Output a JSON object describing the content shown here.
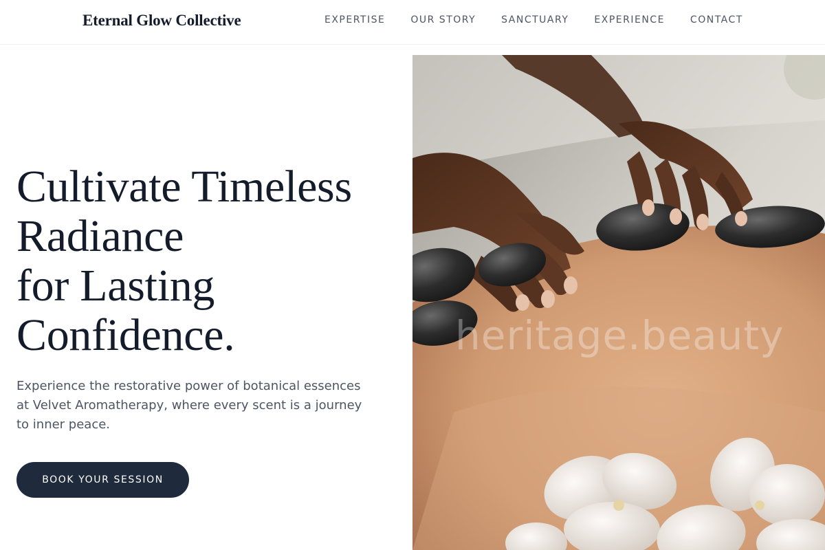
{
  "header": {
    "brand": "Eternal Glow Collective",
    "nav": [
      "EXPERTISE",
      "OUR STORY",
      "SANCTUARY",
      "EXPERIENCE",
      "CONTACT"
    ]
  },
  "hero": {
    "title_lines": [
      "Cultivate Timeless",
      "Radiance",
      "for Lasting",
      "Confidence."
    ],
    "subtitle": "Experience the restorative power of botanical essences at Velvet Aromatherapy, where every scent is a journey to inner peace.",
    "cta_label": "BOOK YOUR SESSION",
    "image": {
      "watermark": "heritage.beauty",
      "colors": {
        "skin": "#cf9a72",
        "hands": "#5a3522",
        "stones": "#2b2b2b",
        "flowers": "#ece6e0",
        "towel": "#d9d4cf"
      }
    }
  },
  "colors": {
    "text_dark": "#141b2b",
    "text_muted": "#4b5563",
    "button": "#1f2a3c"
  }
}
